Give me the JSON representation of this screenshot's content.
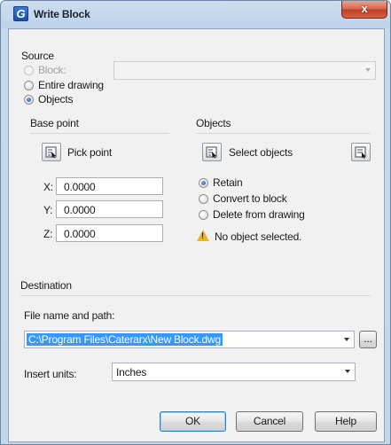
{
  "window": {
    "title": "Write Block",
    "close_label": "x"
  },
  "source": {
    "heading": "Source",
    "options": [
      {
        "label": "Block:",
        "checked": false,
        "enabled": false
      },
      {
        "label": "Entire drawing",
        "checked": false,
        "enabled": true
      },
      {
        "label": "Objects",
        "checked": true,
        "enabled": true
      }
    ],
    "block_combo_value": ""
  },
  "base_point": {
    "heading": "Base point",
    "pick_label": "Pick point",
    "x_label": "X:",
    "y_label": "Y:",
    "z_label": "Z:",
    "x_value": "0.0000",
    "y_value": "0.0000",
    "z_value": "0.0000"
  },
  "objects": {
    "heading": "Objects",
    "select_label": "Select objects",
    "options": [
      {
        "label": "Retain",
        "checked": true
      },
      {
        "label": "Convert to block",
        "checked": false
      },
      {
        "label": "Delete from drawing",
        "checked": false
      }
    ],
    "warning": "No object selected."
  },
  "destination": {
    "heading": "Destination",
    "path_label": "File name and path:",
    "path_value": "C:\\Program Files\\Caterarx\\New Block.dwg",
    "browse_label": "...",
    "units_label": "Insert units:",
    "units_value": "Inches"
  },
  "buttons": {
    "ok": "OK",
    "cancel": "Cancel",
    "help": "Help"
  },
  "colors": {
    "selection": "#3399ff",
    "warning": "#e8b71c",
    "title_bar": "#bdd2ea",
    "close_button": "#c23d21"
  }
}
